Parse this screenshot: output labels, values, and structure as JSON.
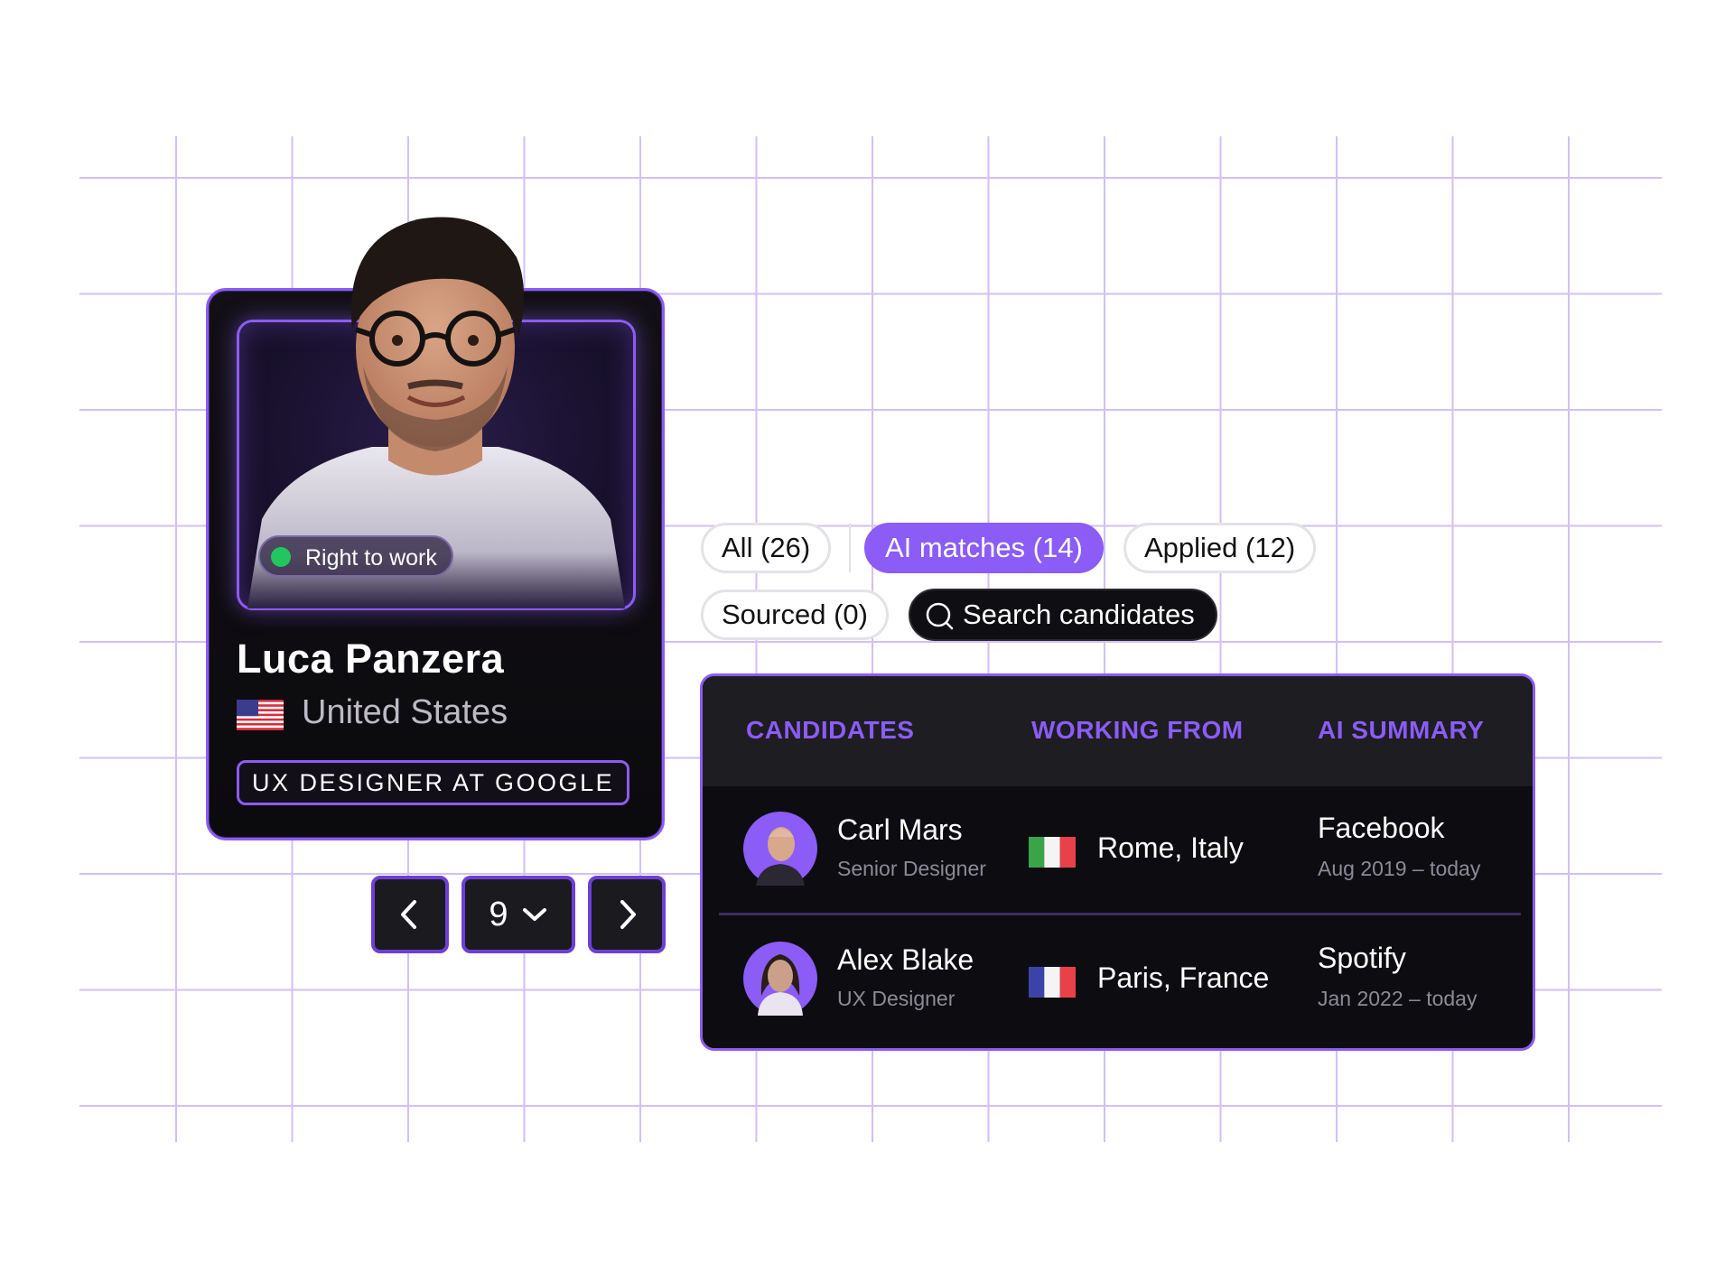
{
  "profile": {
    "badge": "Right to work",
    "name": "Luca Panzera",
    "country": "United States",
    "role": "UX DESIGNER AT GOOGLE"
  },
  "pager": {
    "page": "9",
    "prev_icon": "chevron-left-icon",
    "next_icon": "chevron-right-icon",
    "dropdown_icon": "chevron-down-icon"
  },
  "filters": {
    "tabs": [
      {
        "label": "All (26)",
        "selected": false
      },
      {
        "label": "AI matches (14)",
        "selected": true
      },
      {
        "label": "Applied (12)",
        "selected": false
      },
      {
        "label": "Sourced (0)",
        "selected": false
      }
    ],
    "search_placeholder": "Search candidates"
  },
  "table": {
    "headers": [
      "CANDIDATES",
      "WORKING FROM",
      "AI SUMMARY"
    ],
    "rows": [
      {
        "name": "Carl Mars",
        "role": "Senior Designer",
        "flag": "italy-flag-icon",
        "location": "Rome, Italy",
        "company": "Facebook",
        "period": "Aug 2019 – today"
      },
      {
        "name": "Alex Blake",
        "role": "UX Designer",
        "flag": "france-flag-icon",
        "location": "Paris, France",
        "company": "Spotify",
        "period": "Jan 2022 – today"
      }
    ]
  },
  "colors": {
    "accent": "#8b5cf6",
    "grid": "#d3bff6",
    "status_green": "#22c55e",
    "card_bg": "#0d0c10"
  }
}
